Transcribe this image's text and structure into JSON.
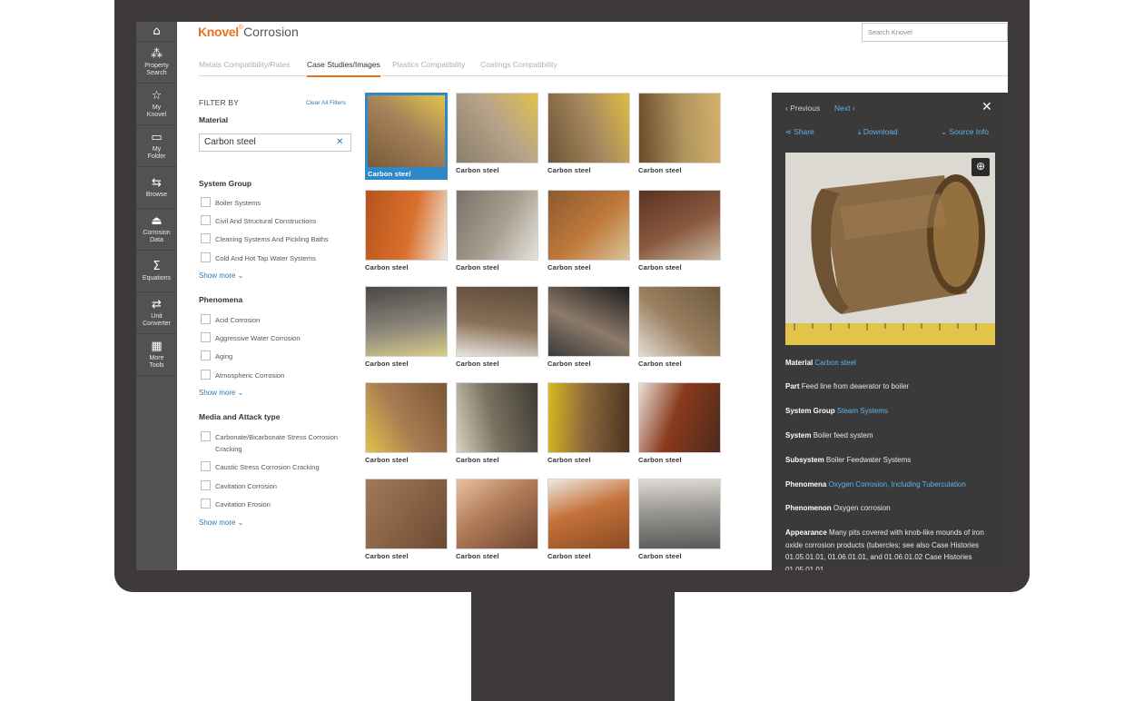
{
  "nav": [
    {
      "label": "",
      "icon": "⌂",
      "name": "home"
    },
    {
      "label": "Property\nSearch",
      "icon": "⁂",
      "name": "property-search"
    },
    {
      "label": "My\nKnovel",
      "icon": "☆",
      "name": "my-knovel"
    },
    {
      "label": "My\nFolder",
      "icon": "▭",
      "name": "my-folder"
    },
    {
      "label": "Browse",
      "icon": "⇆",
      "name": "browse"
    },
    {
      "label": "Corrosion\nData",
      "icon": "⏏",
      "name": "corrosion-data"
    },
    {
      "label": "Equations",
      "icon": "Σ",
      "name": "equations"
    },
    {
      "label": "Unit\nConverter",
      "icon": "⇄",
      "name": "unit-converter"
    },
    {
      "label": "More\nTools",
      "icon": "▦",
      "name": "more-tools"
    }
  ],
  "header": {
    "brand": "Knovel",
    "reg": "®",
    "product": "Corrosion",
    "search_placeholder": "Search Knovel"
  },
  "tabs": [
    "Metals Compatibility/Rates",
    "Case Studies/Images",
    "Plastics Compatibility",
    "Coatings Compatibility"
  ],
  "filters": {
    "filter_by": "FILTER BY",
    "clear_all": "Clear All Filters",
    "material_title": "Material",
    "material_value": "Carbon steel",
    "material_clear": "✕",
    "show_more": "Show more ⌄",
    "groups": [
      {
        "title": "System Group",
        "items": [
          "Boiler Systems",
          "Civil And Structural Constructions",
          "Cleaning Systems And Pickling Baths",
          "Cold And Hot Tap Water Systems"
        ]
      },
      {
        "title": "Phenomena",
        "items": [
          "Acid Corrosion",
          "Aggressive Water Corrosion",
          "Aging",
          "Atmospheric Corrosion"
        ]
      },
      {
        "title": "Media and Attack type",
        "items": [
          "Carbonate/Bicarbonate Stress Corrosion Cracking",
          "Caustic Stress Corrosion Cracking",
          "Cavitation Corrosion",
          "Cavitation Erosion"
        ]
      }
    ]
  },
  "grid_caption": "Carbon steel",
  "detail": {
    "previous": "‹ Previous",
    "next": "Next ›",
    "share": "Share",
    "download": "Download",
    "source_info": "⌄ Source Info",
    "close": "✕",
    "zoom": "⊕",
    "rows": [
      {
        "k": "Material",
        "v": "Carbon steel",
        "link": true
      },
      {
        "k": "Part",
        "v": "Feed line from deaerator to boiler",
        "link": false
      },
      {
        "k": "System Group",
        "v": "Steam Systems",
        "link": true
      },
      {
        "k": "System",
        "v": "Boiler feed system",
        "link": false
      },
      {
        "k": "Subsystem",
        "v": "Boiler Feedwater Systems",
        "link": false
      },
      {
        "k": "Phenomena",
        "v": "Oxygen Corrosion, Including Tuberculation",
        "link": true
      },
      {
        "k": "Phenomenon",
        "v": "Oxygen corrosion",
        "link": false
      },
      {
        "k": "Appearance",
        "v": "Many pits covered with knob-like mounds of iron oxide corrosion products (tubercles; see also Case Histories 01.05.01.01, 01.06.01.01, and 01.06.01.02 Case Histories 01.05.01.01",
        "link": false
      }
    ]
  },
  "colors": {
    "accent": "#e9711c",
    "link": "#2b7bb9",
    "panel": "#3a3a3a",
    "selected": "#2f89c9"
  }
}
